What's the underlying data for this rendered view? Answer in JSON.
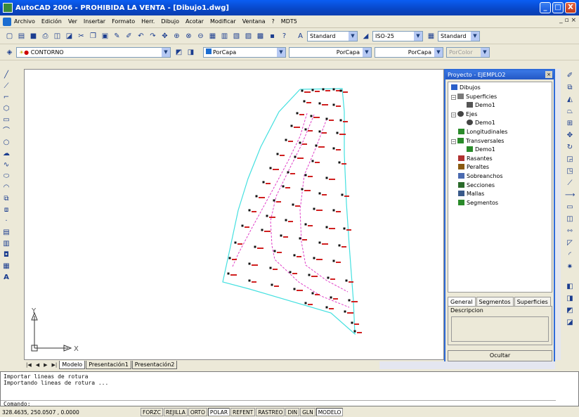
{
  "window": {
    "title": "AutoCAD 2006 - PROHIBIDA LA VENTA - [Dibujo1.dwg]",
    "min": "_",
    "max": "□",
    "close": "X"
  },
  "menu": {
    "items": [
      "Archivo",
      "Edición",
      "Ver",
      "Insertar",
      "Formato",
      "Herr.",
      "Dibujo",
      "Acotar",
      "Modificar",
      "Ventana",
      "?",
      "MDT5"
    ],
    "mdi": "_ ▫ ×"
  },
  "toolbar": {
    "text_style": "Standard",
    "dim_style": "ISO-25",
    "table_style": "Standard"
  },
  "layers": {
    "current_layer": "CONTORNO",
    "color": "PorCapa",
    "linetype": "PorCapa",
    "lineweight": "PorCapa",
    "plotstyle": "PorColor"
  },
  "panel": {
    "title": "Proyecto - EJEMPLO2",
    "tree": [
      {
        "label": "Dibujos",
        "level": 0,
        "icon": "drawings-icon"
      },
      {
        "label": "Superficies",
        "level": 0,
        "icon": "surfaces-icon",
        "expand": "−"
      },
      {
        "label": "Demo1",
        "level": 1,
        "icon": "surface-item-icon"
      },
      {
        "label": "Ejes",
        "level": 0,
        "icon": "alignments-icon",
        "expand": "−"
      },
      {
        "label": "Demo1",
        "level": 1,
        "icon": "alignment-item-icon"
      },
      {
        "label": "Longitudinales",
        "level": 0,
        "icon": "profiles-icon"
      },
      {
        "label": "Transversales",
        "level": 0,
        "icon": "cross-sections-icon",
        "expand": "−"
      },
      {
        "label": "Demo1",
        "level": 1,
        "icon": "cross-section-item-icon"
      },
      {
        "label": "Rasantes",
        "level": 0,
        "icon": "grades-icon"
      },
      {
        "label": "Peraltes",
        "level": 0,
        "icon": "superelevation-icon"
      },
      {
        "label": "Sobreanchos",
        "level": 0,
        "icon": "widening-icon"
      },
      {
        "label": "Secciones",
        "level": 0,
        "icon": "sections-icon"
      },
      {
        "label": "Mallas",
        "level": 0,
        "icon": "meshes-icon"
      },
      {
        "label": "Segmentos",
        "level": 0,
        "icon": "segments-icon"
      }
    ],
    "tabs": [
      "General",
      "Segmentos",
      "Superficies"
    ],
    "description_label": "Descripcion",
    "hide_button": "Ocultar"
  },
  "layout_tabs": [
    "Modelo",
    "Presentación1",
    "Presentación2"
  ],
  "ucs": {
    "x": "X",
    "y": "Y"
  },
  "command": {
    "lines": [
      "Importar lineas de rotura",
      "Importando lineas de rotura ..."
    ],
    "prompt": "Comando:"
  },
  "status": {
    "coords": "328.4635, 250.0507 , 0.0000",
    "buttons": [
      "FORZC",
      "REJILLA",
      "ORTO",
      "POLAR",
      "REFENT",
      "RASTREO",
      "DIN",
      "GLN",
      "MODELO"
    ],
    "active": [
      "POLAR",
      "MODELO"
    ]
  },
  "colors": {
    "boundary": "#44e0e0",
    "breakline": "#e040c8",
    "labels": "#d02020",
    "points": "#111111",
    "titlebar": "#0a5ef3"
  }
}
